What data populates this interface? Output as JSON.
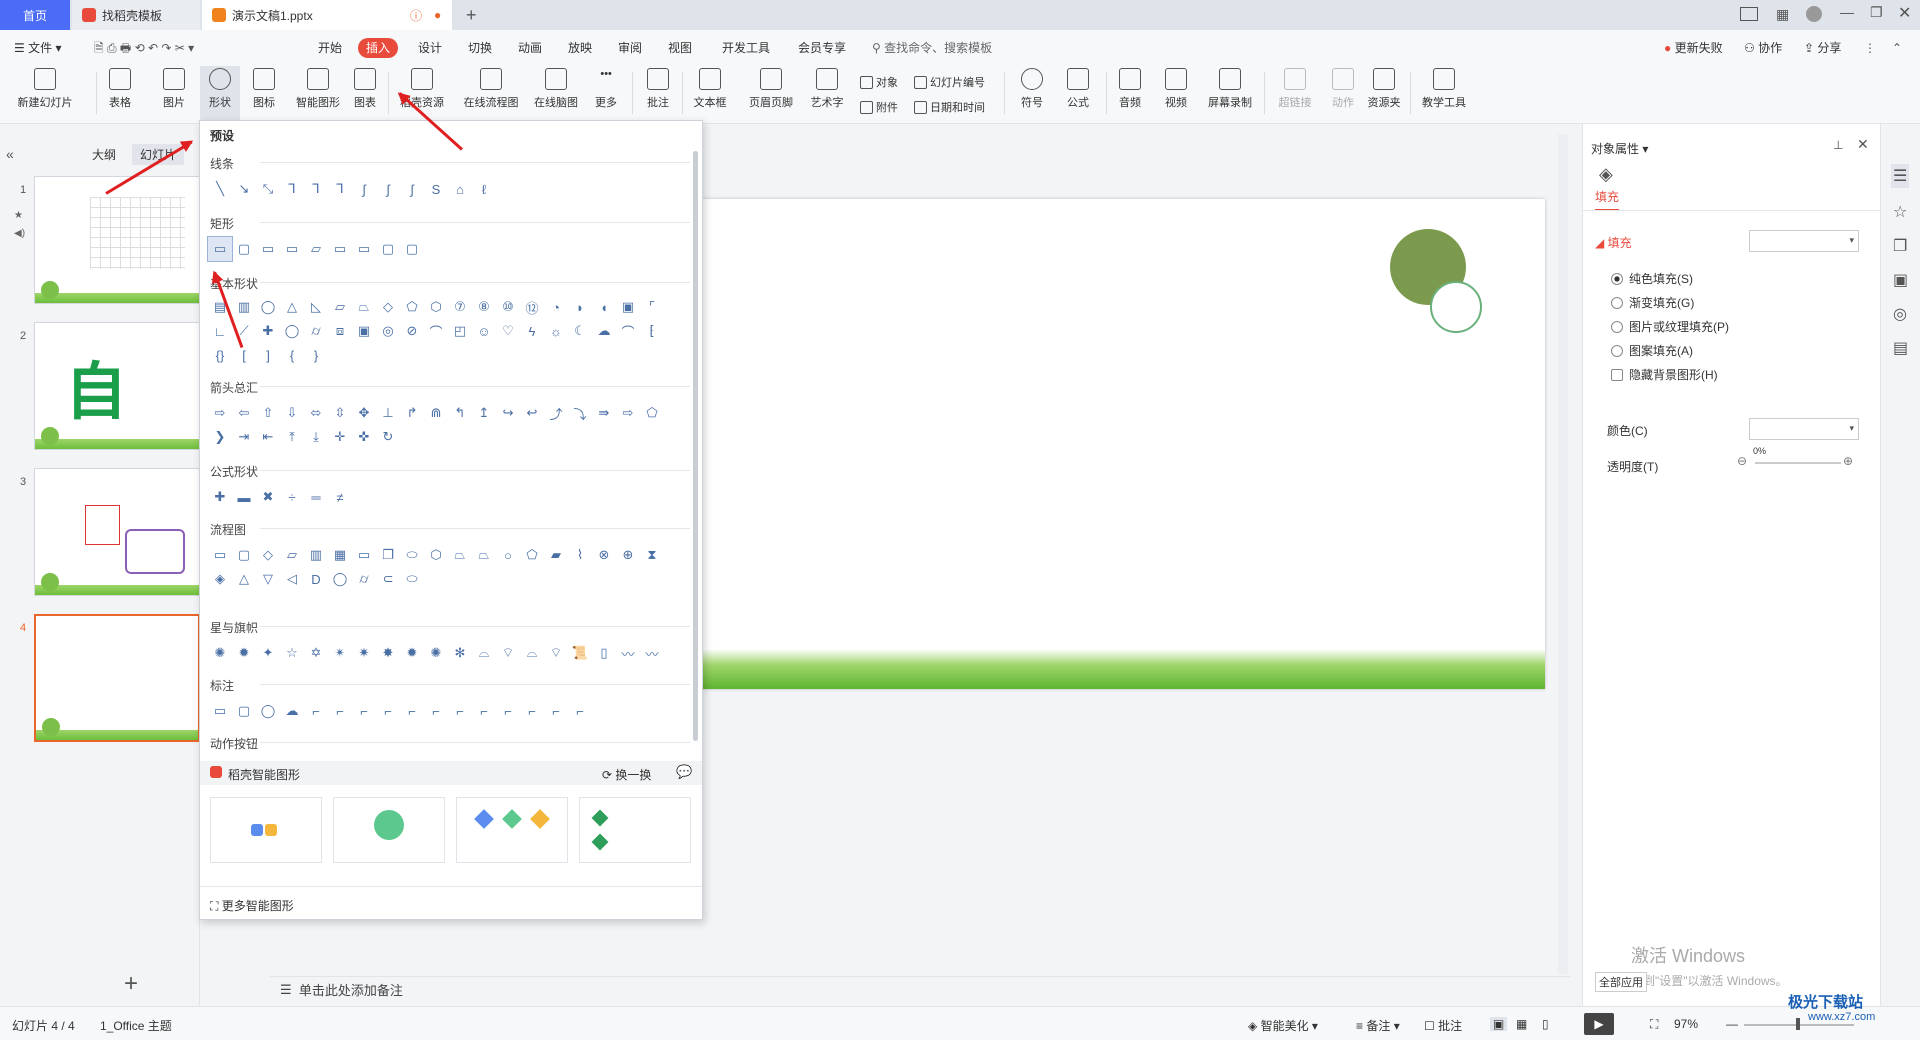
{
  "tabs": {
    "home": "首页",
    "template": "找稻壳模板",
    "doc": "演示文稿1.pptx"
  },
  "menu": {
    "file": "文件",
    "items": [
      "开始",
      "插入",
      "设计",
      "切换",
      "动画",
      "放映",
      "审阅",
      "视图",
      "开发工具",
      "会员专享"
    ],
    "active": "插入",
    "search": "查找命令、搜索模板",
    "update": "更新失败",
    "collab": "协作",
    "share": "分享"
  },
  "ribbon": {
    "new_slide": "新建幻灯片",
    "table": "表格",
    "picture": "图片",
    "shape": "形状",
    "icon": "图标",
    "smart_shape": "智能图形",
    "chart": "图表",
    "daoke": "稻壳资源",
    "flowchart": "在线流程图",
    "mindmap": "在线脑图",
    "more": "更多",
    "comment": "批注",
    "textbox": "文本框",
    "header_footer": "页眉页脚",
    "wordart": "艺术字",
    "object": "对象",
    "slide_num": "幻灯片编号",
    "attach": "附件",
    "datetime": "日期和时间",
    "symbol": "符号",
    "formula": "公式",
    "audio": "音频",
    "video": "视频",
    "screen_rec": "屏幕录制",
    "hyperlink": "超链接",
    "action": "动作",
    "resource": "资源夹",
    "teach": "教学工具"
  },
  "leftpanel": {
    "outline": "大纲",
    "slides": "幻灯片",
    "thumb2_text": "自信",
    "numbers": [
      "1",
      "2",
      "3",
      "4"
    ]
  },
  "dropdown": {
    "preset": "预设",
    "sections": [
      "线条",
      "矩形",
      "基本形状",
      "箭头总汇",
      "公式形状",
      "流程图",
      "星与旗帜",
      "标注",
      "动作按钮"
    ],
    "smart_title": "稻壳智能图形",
    "swap": "换一换",
    "more_smart": "更多智能图形"
  },
  "rightpanel": {
    "title": "对象属性",
    "fill_tab": "填充",
    "fill_section": "填充",
    "options": [
      "纯色填充(S)",
      "渐变填充(G)",
      "图片或纹理填充(P)",
      "图案填充(A)"
    ],
    "hide_bg": "隐藏背景图形(H)",
    "color": "颜色(C)",
    "transparency": "透明度(T)",
    "transparency_val": "0%",
    "apply_all": "全部应用",
    "watermark1": "激活 Windows",
    "watermark2": "转到\"设置\"以激活 Windows。"
  },
  "notes": {
    "placeholder": "单击此处添加备注"
  },
  "status": {
    "slide": "幻灯片 4 / 4",
    "theme": "1_Office 主题",
    "beautify": "智能美化",
    "notes": "备注",
    "comments": "批注",
    "zoom": "97%"
  },
  "site": {
    "name": "极光下载站",
    "url": "www.xz7.com"
  },
  "colors": {
    "accent": "#e84b3c",
    "brand_blue": "#4a6cf7",
    "circle": "#7c9a4e"
  }
}
